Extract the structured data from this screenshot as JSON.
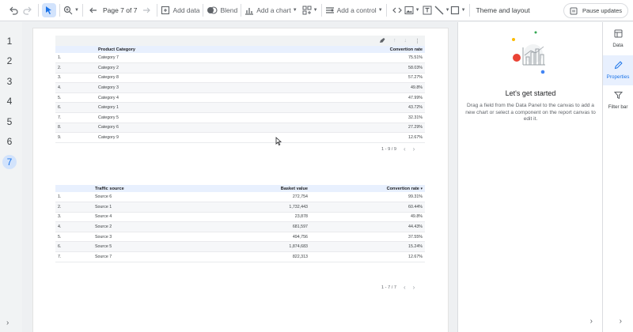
{
  "toolbar": {
    "page_label": "Page 7 of 7",
    "add_data": "Add data",
    "blend": "Blend",
    "add_chart": "Add a chart",
    "add_control": "Add a control",
    "theme_layout": "Theme and layout",
    "pause_updates": "Pause updates"
  },
  "rail": {
    "pages": [
      "1",
      "2",
      "3",
      "4",
      "5",
      "6",
      "7"
    ],
    "active_page": "7"
  },
  "table1": {
    "headers": [
      "",
      "Product Category",
      "Convertion rate"
    ],
    "rows": [
      [
        "1.",
        "Category 7",
        "75.51%"
      ],
      [
        "2.",
        "Category 2",
        "58.03%"
      ],
      [
        "3.",
        "Category 8",
        "57.27%"
      ],
      [
        "4.",
        "Category 3",
        "49.8%"
      ],
      [
        "5.",
        "Category 4",
        "47.99%"
      ],
      [
        "6.",
        "Category 1",
        "43.72%"
      ],
      [
        "7.",
        "Category 5",
        "32.31%"
      ],
      [
        "8.",
        "Category 6",
        "27.29%"
      ],
      [
        "9.",
        "Category 9",
        "12.67%"
      ]
    ],
    "pager": "1 - 9 / 9"
  },
  "table2": {
    "headers": [
      "",
      "Traffic source",
      "Basket value",
      "Convertion rate"
    ],
    "sort_indicator": "▾",
    "rows": [
      [
        "1.",
        "Source 6",
        "272,754",
        "99.31%"
      ],
      [
        "2.",
        "Source 1",
        "1,732,443",
        "60.44%"
      ],
      [
        "3.",
        "Source 4",
        "23,878",
        "49.8%"
      ],
      [
        "4.",
        "Source 2",
        "681,597",
        "44.43%"
      ],
      [
        "5.",
        "Source 3",
        "494,756",
        "37.55%"
      ],
      [
        "6.",
        "Source 5",
        "1,874,683",
        "15.24%"
      ],
      [
        "7.",
        "Source 7",
        "822,313",
        "12.67%"
      ]
    ],
    "pager": "1 - 7 / 7"
  },
  "panel": {
    "title": "Let's get started",
    "description": "Drag a field from the Data Panel to the canvas to add a new chart or select a component on the report canvas to edit it."
  },
  "side_tabs": [
    {
      "label": "Data",
      "icon": "data-icon"
    },
    {
      "label": "Properties",
      "icon": "pencil-icon",
      "active": true
    },
    {
      "label": "Filter bar",
      "icon": "filter-icon"
    }
  ],
  "colors": {
    "accent": "#1a73e8",
    "selected_bg": "#d2e3fc",
    "header_bg": "#e8f0fe"
  }
}
